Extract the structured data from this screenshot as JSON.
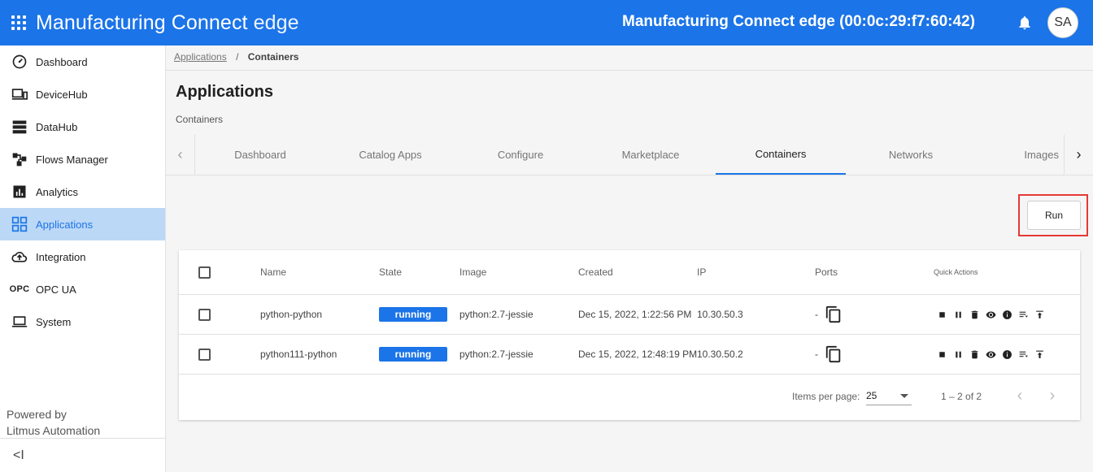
{
  "header": {
    "app_title_main": "Manufacturing Connect",
    "app_title_suffix": "edge",
    "device_title": "Manufacturing Connect edge (00:0c:29:f7:60:42)",
    "avatar_initials": "SA",
    "brand_color": "#1b74e8"
  },
  "sidebar": {
    "items": [
      {
        "label": "Dashboard",
        "icon": "speedometer-icon"
      },
      {
        "label": "DeviceHub",
        "icon": "devices-icon"
      },
      {
        "label": "DataHub",
        "icon": "storage-icon"
      },
      {
        "label": "Flows Manager",
        "icon": "flow-icon"
      },
      {
        "label": "Analytics",
        "icon": "analytics-icon"
      },
      {
        "label": "Applications",
        "icon": "apps-grid-icon",
        "active": true
      },
      {
        "label": "Integration",
        "icon": "cloud-upload-icon"
      },
      {
        "label": "OPC UA",
        "icon": "opc-icon"
      },
      {
        "label": "System",
        "icon": "laptop-icon"
      }
    ],
    "opc_icon_text": "OPC",
    "powered_by": "Powered by",
    "company": "Litmus Automation",
    "collapse_glyph": "<I"
  },
  "breadcrumb": {
    "parent": "Applications",
    "separator": "/",
    "current": "Containers"
  },
  "page": {
    "title": "Applications",
    "subtitle": "Containers"
  },
  "tabs": {
    "items": [
      "Dashboard",
      "Catalog Apps",
      "Configure",
      "Marketplace",
      "Containers",
      "Networks",
      "Images"
    ],
    "active": "Containers"
  },
  "actions": {
    "run_label": "Run"
  },
  "table": {
    "columns": [
      "Name",
      "State",
      "Image",
      "Created",
      "IP",
      "Ports",
      "Quick Actions"
    ],
    "rows": [
      {
        "name": "python-python",
        "state": "running",
        "image": "python:2.7-jessie",
        "created": "Dec 15, 2022, 1:22:56 PM",
        "ip": "10.30.50.3",
        "ports": "-"
      },
      {
        "name": "python111-python",
        "state": "running",
        "image": "python:2.7-jessie",
        "created": "Dec 15, 2022, 12:48:19 PM",
        "ip": "10.30.50.2",
        "ports": "-"
      }
    ],
    "quick_actions": [
      "stop-icon",
      "pause-icon",
      "delete-icon",
      "view-icon",
      "info-icon",
      "logs-icon",
      "upload-icon"
    ]
  },
  "pagination": {
    "items_per_page_label": "Items per page:",
    "items_per_page_value": "25",
    "range_text": "1 – 2 of 2"
  }
}
